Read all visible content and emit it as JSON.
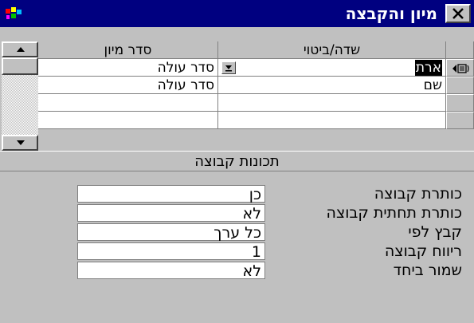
{
  "window": {
    "title": "מיון והקבצה"
  },
  "grid": {
    "headers": {
      "field": "שדה/ביטוי",
      "sort": "סדר מיון"
    },
    "rows": [
      {
        "field": "ארת",
        "sort": "סדר עולה"
      },
      {
        "field": "שם",
        "sort": "סדר עולה"
      },
      {
        "field": "",
        "sort": ""
      },
      {
        "field": "",
        "sort": ""
      }
    ]
  },
  "group_properties": {
    "title": "תכונות קבוצה",
    "items": [
      {
        "label": "כותרת קבוצה",
        "value": "כן"
      },
      {
        "label": "כותרת תחתית קבוצה",
        "value": "לא"
      },
      {
        "label": "קבץ לפי",
        "value": "כל ערך"
      },
      {
        "label": "ריווח קבוצה",
        "value": "1"
      },
      {
        "label": "שמור ביחד",
        "value": "לא"
      }
    ]
  },
  "colors": {
    "title_bar": "#000080",
    "face": "#c0c0c0",
    "window": "#ffffff"
  }
}
